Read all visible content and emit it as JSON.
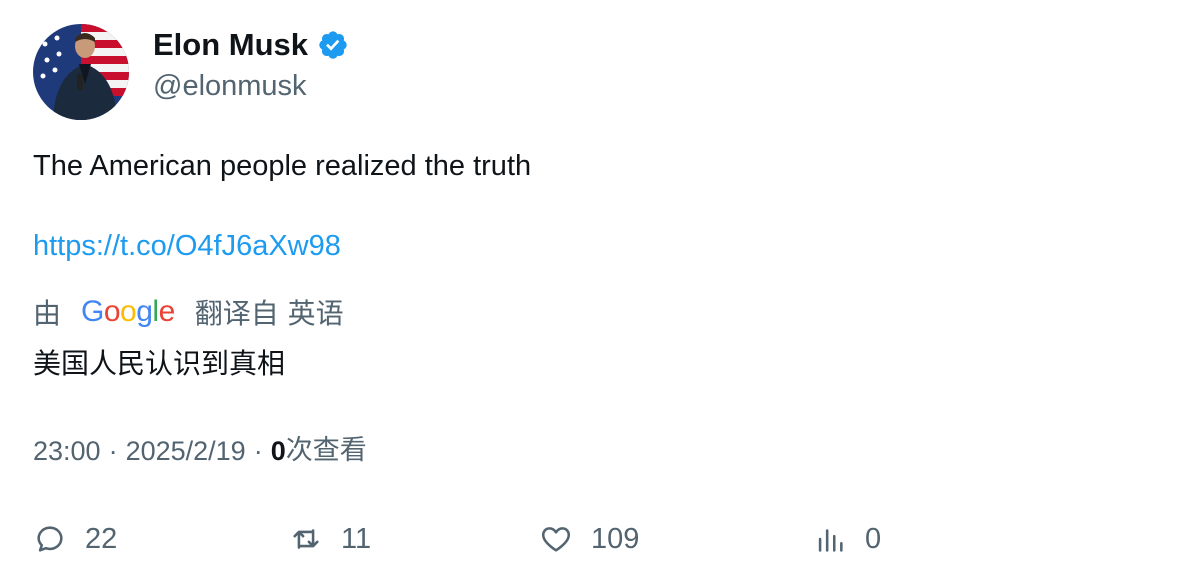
{
  "author": {
    "display_name": "Elon Musk",
    "handle": "@elonmusk",
    "verified": true,
    "avatar_icon": "avatar-photo"
  },
  "tweet": {
    "text": "The American people realized the truth",
    "link": "https://t.co/O4fJ6aXw98"
  },
  "translation": {
    "prefix": "由",
    "provider_letters": [
      "G",
      "o",
      "o",
      "g",
      "l",
      "e"
    ],
    "suffix": "翻译自 英语",
    "text": "美国人民认识到真相"
  },
  "meta": {
    "time": "23:00",
    "separator": "·",
    "date": "2025/2/19",
    "views_count": "0",
    "views_label": "次查看"
  },
  "actions": {
    "replies": "22",
    "retweets": "11",
    "likes": "109",
    "views": "0"
  },
  "colors": {
    "link": "#1d9bf0",
    "secondary_text": "#536471",
    "primary_text": "#0f1419",
    "verified_badge": "#1d9bf0"
  }
}
